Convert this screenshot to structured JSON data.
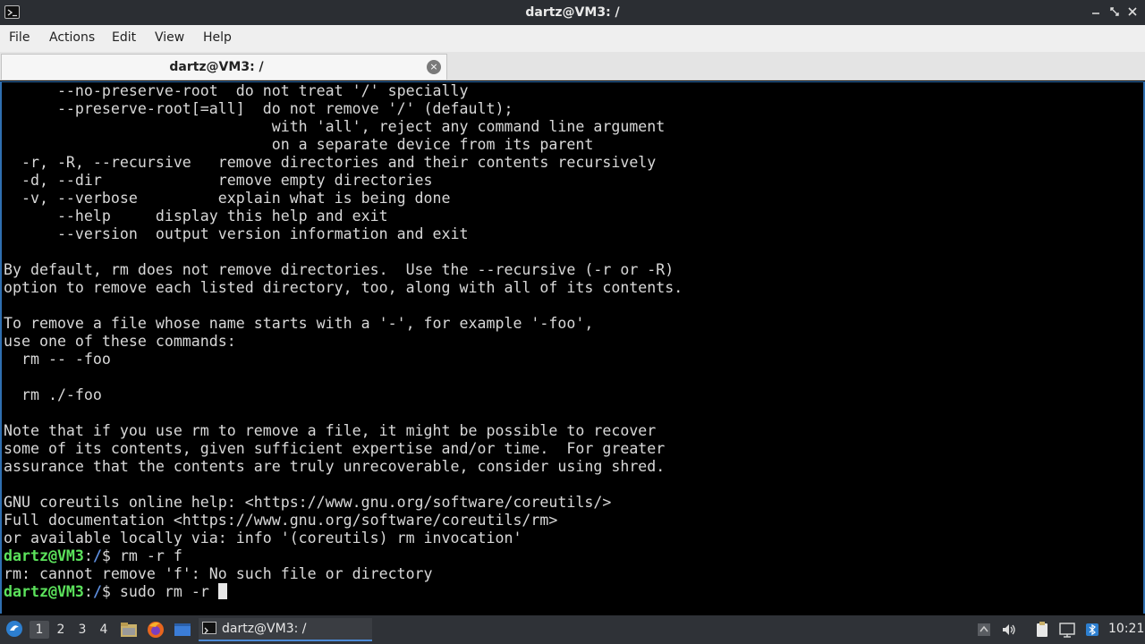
{
  "window": {
    "title": "dartz@VM3: /",
    "icons": [
      "terminal-icon",
      "minimize-icon",
      "maximize-icon",
      "close-icon"
    ]
  },
  "menubar": {
    "file": "File",
    "actions": "Actions",
    "edit": "Edit",
    "view": "View",
    "help": "Help"
  },
  "tab": {
    "label": "dartz@VM3: /",
    "close": "×"
  },
  "terminal": {
    "lines": [
      "      --no-preserve-root  do not treat '/' specially",
      "      --preserve-root[=all]  do not remove '/' (default);",
      "                              with 'all', reject any command line argument",
      "                              on a separate device from its parent",
      "  -r, -R, --recursive   remove directories and their contents recursively",
      "  -d, --dir             remove empty directories",
      "  -v, --verbose         explain what is being done",
      "      --help     display this help and exit",
      "      --version  output version information and exit",
      "",
      "By default, rm does not remove directories.  Use the --recursive (-r or -R)",
      "option to remove each listed directory, too, along with all of its contents.",
      "",
      "To remove a file whose name starts with a '-', for example '-foo',",
      "use one of these commands:",
      "  rm -- -foo",
      "",
      "  rm ./-foo",
      "",
      "Note that if you use rm to remove a file, it might be possible to recover",
      "some of its contents, given sufficient expertise and/or time.  For greater",
      "assurance that the contents are truly unrecoverable, consider using shred.",
      "",
      "GNU coreutils online help: <https://www.gnu.org/software/coreutils/>",
      "Full documentation <https://www.gnu.org/software/coreutils/rm>",
      "or available locally via: info '(coreutils) rm invocation'"
    ],
    "prompt1": {
      "user": "dartz@VM3",
      "sep": ":",
      "path": "/",
      "dollar": "$ ",
      "command": "rm -r f"
    },
    "error_line": "rm: cannot remove 'f': No such file or directory",
    "prompt2": {
      "user": "dartz@VM3",
      "sep": ":",
      "path": "/",
      "dollar": "$ ",
      "command": "sudo rm -r "
    }
  },
  "taskbar": {
    "workspaces": [
      "1",
      "2",
      "3",
      "4"
    ],
    "active_workspace": "1",
    "launchers": [
      "start-menu-icon",
      "file-manager-icon",
      "firefox-icon",
      "desktop-icon"
    ],
    "task_label": "dartz@VM3: /",
    "tray": [
      "up-arrow-icon",
      "volume-icon",
      "clipboard-icon",
      "network-icon",
      "bluetooth-icon"
    ],
    "clock": "10:21"
  }
}
